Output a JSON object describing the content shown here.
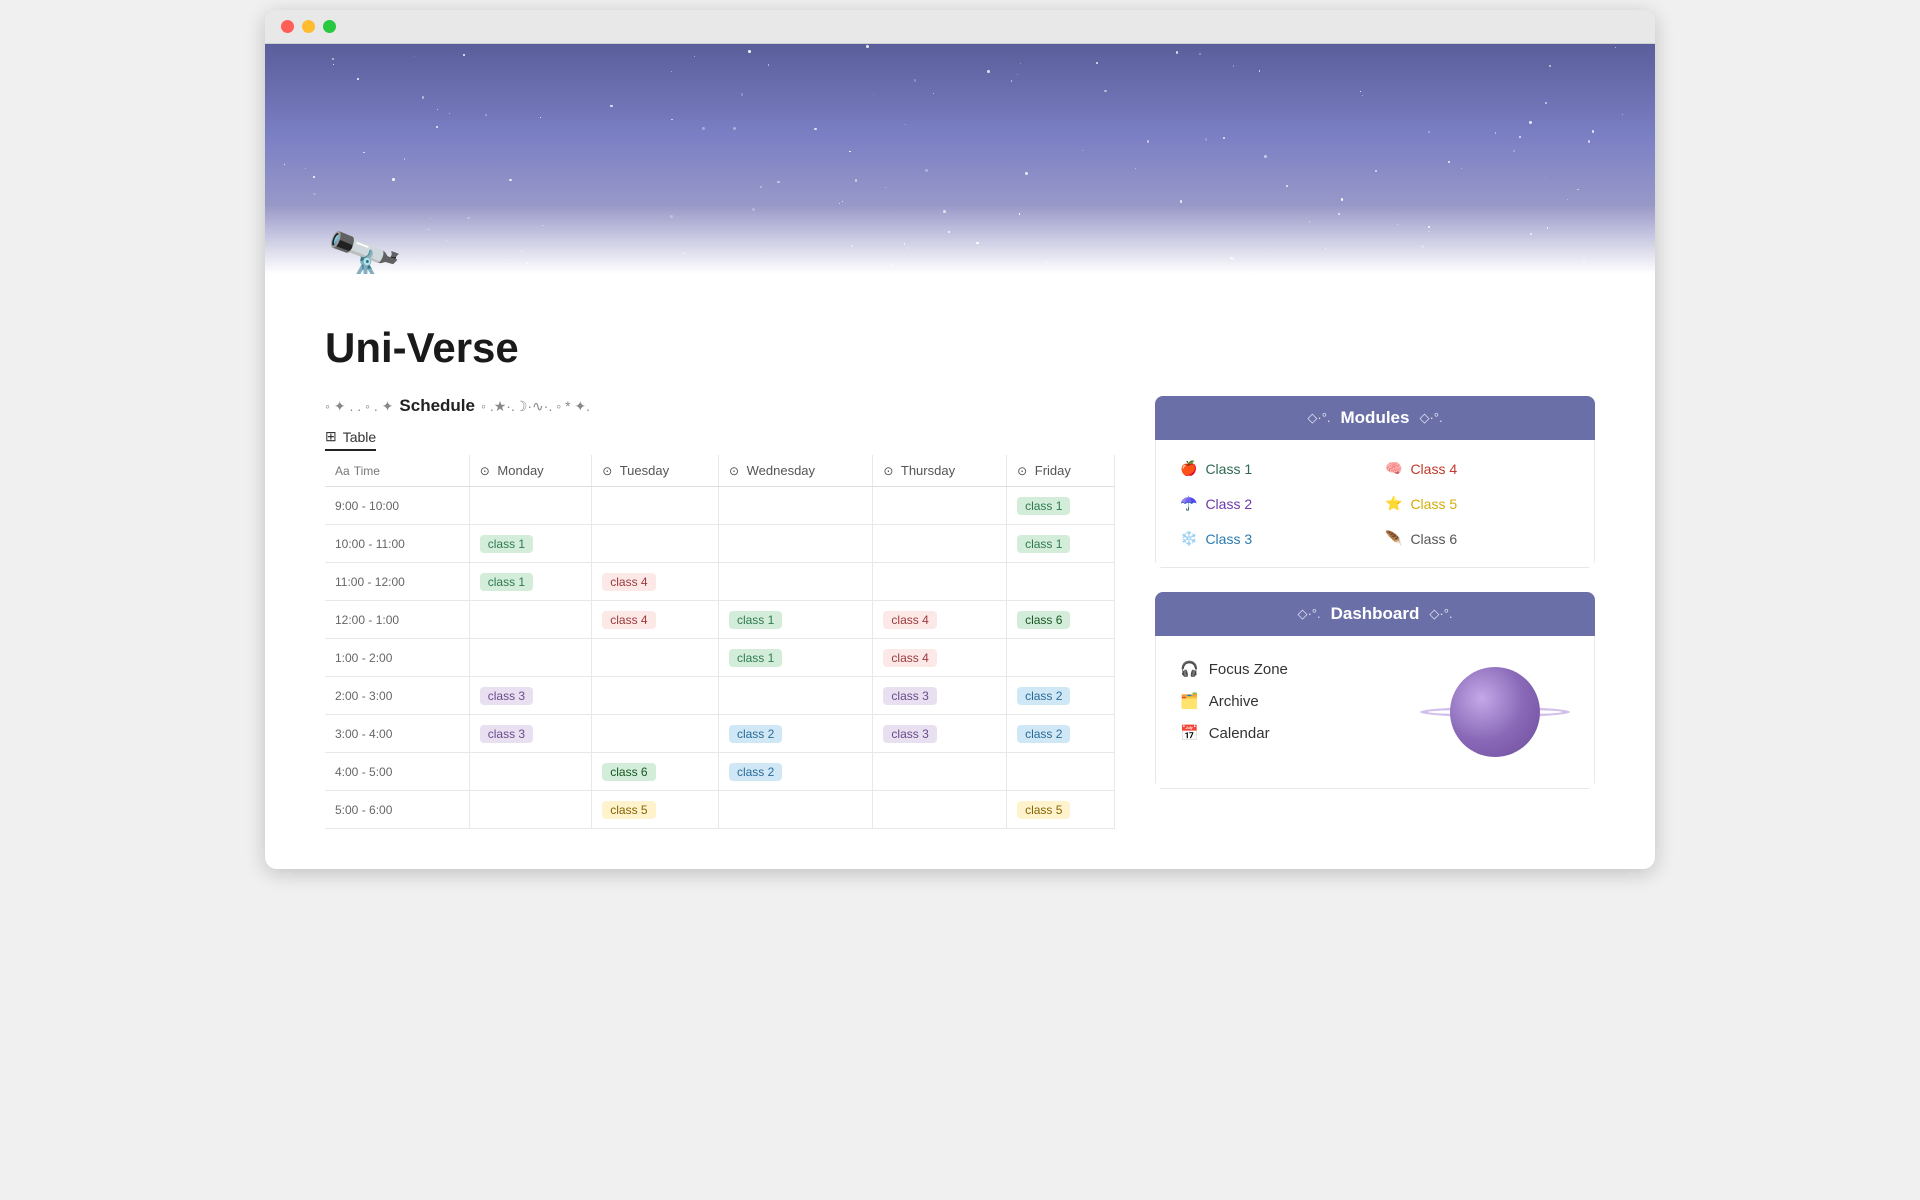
{
  "window": {
    "traffic_lights": [
      "close",
      "minimize",
      "maximize"
    ]
  },
  "banner": {
    "emoji": "🔭"
  },
  "page": {
    "title": "Uni-Verse"
  },
  "schedule": {
    "section_deco_left": "◦  ✦  .  .  ◦  .  ✦",
    "section_title": "Schedule",
    "section_deco_right": "◦  .★·.☽·∿·.  ◦  *  ✦.",
    "table_label": "Table",
    "columns": [
      "Time",
      "Monday",
      "Tuesday",
      "Wednesday",
      "Thursday",
      "Friday"
    ],
    "rows": [
      {
        "time": "9:00 - 10:00",
        "mon": "",
        "tue": "",
        "wed": "",
        "thu": "",
        "fri": "class 1"
      },
      {
        "time": "10:00 - 11:00",
        "mon": "class 1",
        "tue": "",
        "wed": "",
        "thu": "",
        "fri": "class 1"
      },
      {
        "time": "11:00 - 12:00",
        "mon": "class 1",
        "tue": "class 4",
        "wed": "",
        "thu": "",
        "fri": ""
      },
      {
        "time": "12:00 - 1:00",
        "mon": "",
        "tue": "class 4",
        "wed": "class 1",
        "thu": "class 4",
        "fri": "class 6"
      },
      {
        "time": "1:00 - 2:00",
        "mon": "",
        "tue": "",
        "wed": "class 1",
        "thu": "class 4",
        "fri": ""
      },
      {
        "time": "2:00 - 3:00",
        "mon": "class 3",
        "tue": "",
        "wed": "",
        "thu": "class 3",
        "fri": "class 2"
      },
      {
        "time": "3:00 - 4:00",
        "mon": "class 3",
        "tue": "",
        "wed": "class 2",
        "thu": "class 3",
        "fri": "class 2"
      },
      {
        "time": "4:00 - 5:00",
        "mon": "",
        "tue": "class 6",
        "wed": "class 2",
        "thu": "",
        "fri": ""
      },
      {
        "time": "5:00 - 6:00",
        "mon": "",
        "tue": "class 5",
        "wed": "",
        "thu": "",
        "fri": "class 5"
      }
    ]
  },
  "modules_panel": {
    "header_deco_left": "◇·°.",
    "title": "Modules",
    "header_deco_right": "◇·°.",
    "items": [
      {
        "emoji": "🍎",
        "label": "Class 1",
        "class_key": "class1"
      },
      {
        "emoji": "🧠",
        "label": "Class 4",
        "class_key": "class4"
      },
      {
        "emoji": "☂️",
        "label": "Class 2",
        "class_key": "class2"
      },
      {
        "emoji": "⭐",
        "label": "Class 5",
        "class_key": "class5"
      },
      {
        "emoji": "❄️",
        "label": "Class 3",
        "class_key": "class3"
      },
      {
        "emoji": "🪶",
        "label": "Class 6",
        "class_key": "class6"
      }
    ]
  },
  "dashboard_panel": {
    "header_deco_left": "◇·°.",
    "title": "Dashboard",
    "header_deco_right": "◇·°.",
    "links": [
      {
        "emoji": "🎧",
        "label": "Focus Zone"
      },
      {
        "emoji": "🗂️",
        "label": "Archive"
      },
      {
        "emoji": "📅",
        "label": "Calendar"
      }
    ]
  }
}
